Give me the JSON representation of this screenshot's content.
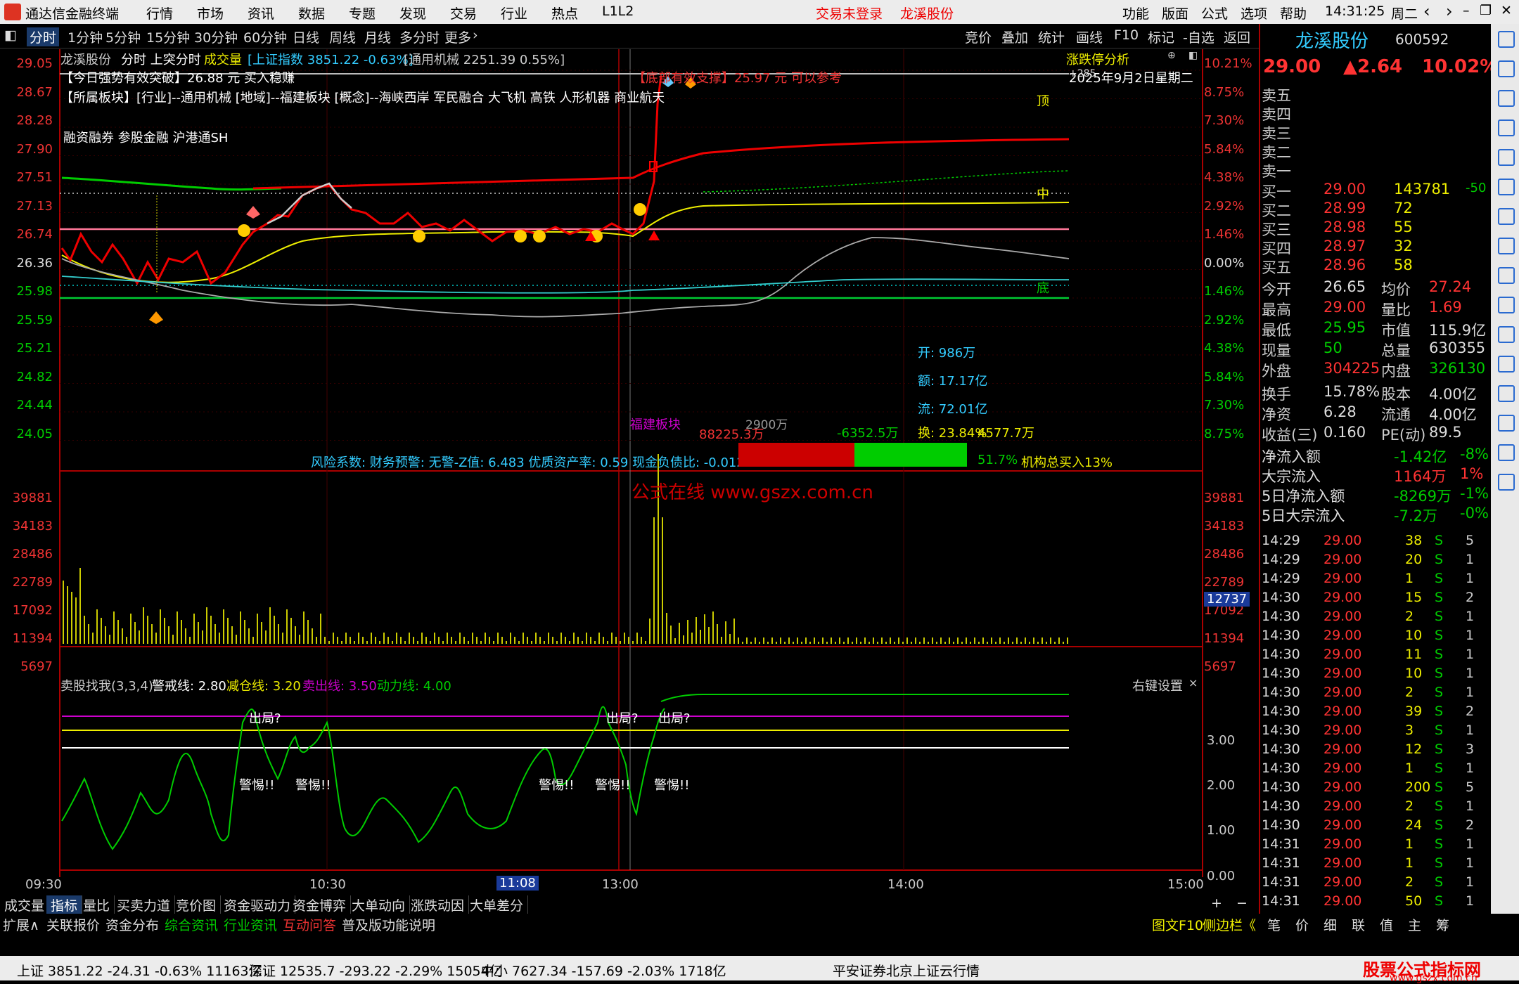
{
  "titlebar": {
    "app_title": "通达信金融终端",
    "menus": [
      "行情",
      "市场",
      "资讯",
      "数据",
      "专题",
      "发现",
      "交易",
      "行业",
      "热点",
      "L1L2"
    ],
    "login": "交易未登录",
    "stock": "龙溪股份",
    "right_menus": [
      "功能",
      "版面",
      "公式",
      "选项",
      "帮助"
    ],
    "time": "14:31:25",
    "weekday": "周二"
  },
  "periods": [
    "分时",
    "1分钟",
    "5分钟",
    "15分钟",
    "30分钟",
    "60分钟",
    "日线",
    "周线",
    "月线",
    "多分时",
    "更多"
  ],
  "toolbar_right": [
    "竞价",
    "叠加",
    "统计",
    "画线",
    "F10",
    "标记",
    "-自选",
    "返回"
  ],
  "chart_header": {
    "name": "龙溪股份",
    "mode": "分时 上突分时",
    "vol_label": "成交量",
    "index": "[上证指数 3851.22 -0.63%]",
    "industry": "[通用机械 2251.39 0.55%]",
    "analysis": "涨跌停分析"
  },
  "annotations": {
    "line1": "【今日强势有效突破】26.88 元 买入稳赚",
    "line2": "【所属板块】[行业]--通用机械 [地域]--福建板块 [概念]--海峡西岸 军民融合 大飞机 高铁 人形机器 商业航天",
    "line3": "融资融券 参股金融 沪港通SH",
    "support": "【底部有效支撑】25.97 元 可以参考",
    "date": "2025年9月2日星期二",
    "top": "顶",
    "mid": "中",
    "bottom": "底",
    "open": "开: 986万",
    "amount": "额: 17.17亿",
    "flow": "流: 72.01亿",
    "turnover": "换: 23.84%",
    "v4577": "4577.7万",
    "sector": "福建板块",
    "v88225": "88225.3万",
    "v2900": "2900万",
    "v6352": "-6352.5万",
    "risk": "风险系数: 财务预警: 无警-Z值: 6.483 优质资产率: 0.59 现金负债比: -0.012",
    "pct517": "51.7%",
    "inst": "机构总买入13%",
    "watermark": "公式在线  www.gszx.com.cn",
    "x0": "+285",
    "xm": "中"
  },
  "price_axis_left": [
    "29.05",
    "28.67",
    "28.28",
    "27.90",
    "27.51",
    "27.13",
    "26.74",
    "26.36",
    "25.98",
    "25.59",
    "25.21",
    "24.82",
    "24.44",
    "24.05"
  ],
  "price_axis_right": [
    "10.21%",
    "8.75%",
    "7.30%",
    "5.84%",
    "4.38%",
    "2.92%",
    "1.46%",
    "0.00%",
    "1.46%",
    "2.92%",
    "4.38%",
    "5.84%",
    "7.30%",
    "8.75%"
  ],
  "vol_axis": [
    "39881",
    "34183",
    "28486",
    "22789",
    "17092",
    "11394",
    "5697"
  ],
  "vol_marker": "12737",
  "indicator": {
    "title": "卖股找我(3,3,4)",
    "warn": "警戒线: 2.80",
    "reduce": "减仓线: 3.20",
    "sell": "卖出线: 3.50",
    "power": "动力线: 4.00",
    "settings": "右键设置",
    "ticks": [
      "3.00",
      "2.00",
      "1.00",
      "0.00"
    ],
    "out": "出局?",
    "alert": "警惕!!"
  },
  "time_axis": [
    "09:30",
    "10:30",
    "11:08",
    "13:00",
    "14:00",
    "15:00"
  ],
  "tabs1": [
    "成交量",
    "指标",
    "量比",
    "买卖力道",
    "竞价图",
    "资金驱动力",
    "资金博弈",
    "大单动向",
    "涨跌动因",
    "大单差分"
  ],
  "tabs2": [
    "扩展∧",
    "关联报价",
    "资金分布",
    "综合资讯",
    "行业资讯",
    "互动问答",
    "普及版功能说明"
  ],
  "tabs2_right": [
    "图文F10",
    "侧边栏《"
  ],
  "right_panel": {
    "name": "龙溪股份",
    "code": "600592",
    "price": "29.00",
    "change": "▲2.64",
    "pct": "10.02%",
    "sells": [
      "卖五",
      "卖四",
      "卖三",
      "卖二",
      "卖一"
    ],
    "buys": [
      {
        "label": "买一",
        "price": "29.00",
        "vol": "143781",
        "chg": "-50"
      },
      {
        "label": "买二",
        "price": "28.99",
        "vol": "72",
        "chg": ""
      },
      {
        "label": "买三",
        "price": "28.98",
        "vol": "55",
        "chg": ""
      },
      {
        "label": "买四",
        "price": "28.97",
        "vol": "32",
        "chg": ""
      },
      {
        "label": "买五",
        "price": "28.96",
        "vol": "58",
        "chg": ""
      }
    ],
    "stats": [
      [
        "今开",
        "26.65",
        "均价",
        "27.24"
      ],
      [
        "最高",
        "29.00",
        "量比",
        "1.69"
      ],
      [
        "最低",
        "25.95",
        "市值",
        "115.9亿"
      ],
      [
        "现量",
        "50",
        "总量",
        "630355"
      ],
      [
        "外盘",
        "304225",
        "内盘",
        "326130"
      ],
      [
        "换手",
        "15.78%",
        "股本",
        "4.00亿"
      ],
      [
        "净资",
        "6.28",
        "流通",
        "4.00亿"
      ],
      [
        "收益(三)",
        "0.160",
        "PE(动)",
        "89.5"
      ]
    ],
    "flows": [
      [
        "净流入额",
        "-1.42亿",
        "-8%"
      ],
      [
        "大宗流入",
        "1164万",
        "1%"
      ],
      [
        "5日净流入额",
        "-8269万",
        "-1%"
      ],
      [
        "5日大宗流入",
        "-7.2万",
        "-0%"
      ]
    ],
    "ticks": [
      [
        "14:29",
        "29.00",
        "38",
        "S",
        "5"
      ],
      [
        "14:29",
        "29.00",
        "20",
        "S",
        "1"
      ],
      [
        "14:29",
        "29.00",
        "1",
        "S",
        "1"
      ],
      [
        "14:30",
        "29.00",
        "15",
        "S",
        "2"
      ],
      [
        "14:30",
        "29.00",
        "2",
        "S",
        "1"
      ],
      [
        "14:30",
        "29.00",
        "10",
        "S",
        "1"
      ],
      [
        "14:30",
        "29.00",
        "11",
        "S",
        "1"
      ],
      [
        "14:30",
        "29.00",
        "10",
        "S",
        "1"
      ],
      [
        "14:30",
        "29.00",
        "2",
        "S",
        "1"
      ],
      [
        "14:30",
        "29.00",
        "39",
        "S",
        "2"
      ],
      [
        "14:30",
        "29.00",
        "3",
        "S",
        "1"
      ],
      [
        "14:30",
        "29.00",
        "12",
        "S",
        "3"
      ],
      [
        "14:30",
        "29.00",
        "1",
        "S",
        "1"
      ],
      [
        "14:30",
        "29.00",
        "200",
        "S",
        "5"
      ],
      [
        "14:30",
        "29.00",
        "2",
        "S",
        "1"
      ],
      [
        "14:30",
        "29.00",
        "24",
        "S",
        "2"
      ],
      [
        "14:31",
        "29.00",
        "1",
        "S",
        "1"
      ],
      [
        "14:31",
        "29.00",
        "1",
        "S",
        "1"
      ],
      [
        "14:31",
        "29.00",
        "2",
        "S",
        "1"
      ],
      [
        "14:31",
        "29.00",
        "50",
        "S",
        "1"
      ]
    ],
    "bottom_tabs": [
      "笔",
      "价",
      "细",
      "联",
      "值",
      "主",
      "筹"
    ]
  },
  "statusbar": {
    "sh": "上证 3851.22 -24.31 -0.63% 11163亿",
    "sz": "深证 12535.7 -293.22 -2.29% 15054亿",
    "zx": "中小 7627.34 -157.69 -2.03% 1718亿",
    "broker": "平安证券北京上证云行情",
    "brand": "股票公式指标网",
    "url": "www.gszx.com.cn"
  },
  "sidebar_icons": [
    "gear-icon",
    "arrow-up-icon",
    "arrow-down-icon",
    "chart-icon",
    "list-icon",
    "fio-icon",
    "fin-icon",
    "f10-icon",
    "calendar-icon",
    "day",
    "week",
    "month",
    "N",
    "多",
    "季",
    "年"
  ]
}
